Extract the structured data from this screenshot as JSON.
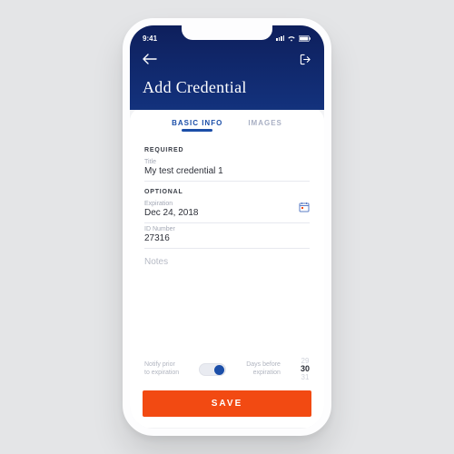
{
  "status": {
    "time": "9:41"
  },
  "header": {
    "title": "Add Credential"
  },
  "tabs": {
    "basic": "BASIC INFO",
    "images": "IMAGES"
  },
  "sections": {
    "required": "REQUIRED",
    "optional": "OPTIONAL"
  },
  "fields": {
    "title": {
      "label": "Title",
      "value": "My test credential 1"
    },
    "expiration": {
      "label": "Expiration",
      "value": "Dec 24, 2018"
    },
    "idnum": {
      "label": "ID Number",
      "value": "27316"
    },
    "notes": {
      "placeholder": "Notes"
    }
  },
  "notify": {
    "leftLabel": "Notify prior\nto expiration",
    "rightLabel": "Days before\nexpiration",
    "options": {
      "a": "29",
      "b": "30",
      "c": "31"
    }
  },
  "actions": {
    "save": "SAVE"
  }
}
